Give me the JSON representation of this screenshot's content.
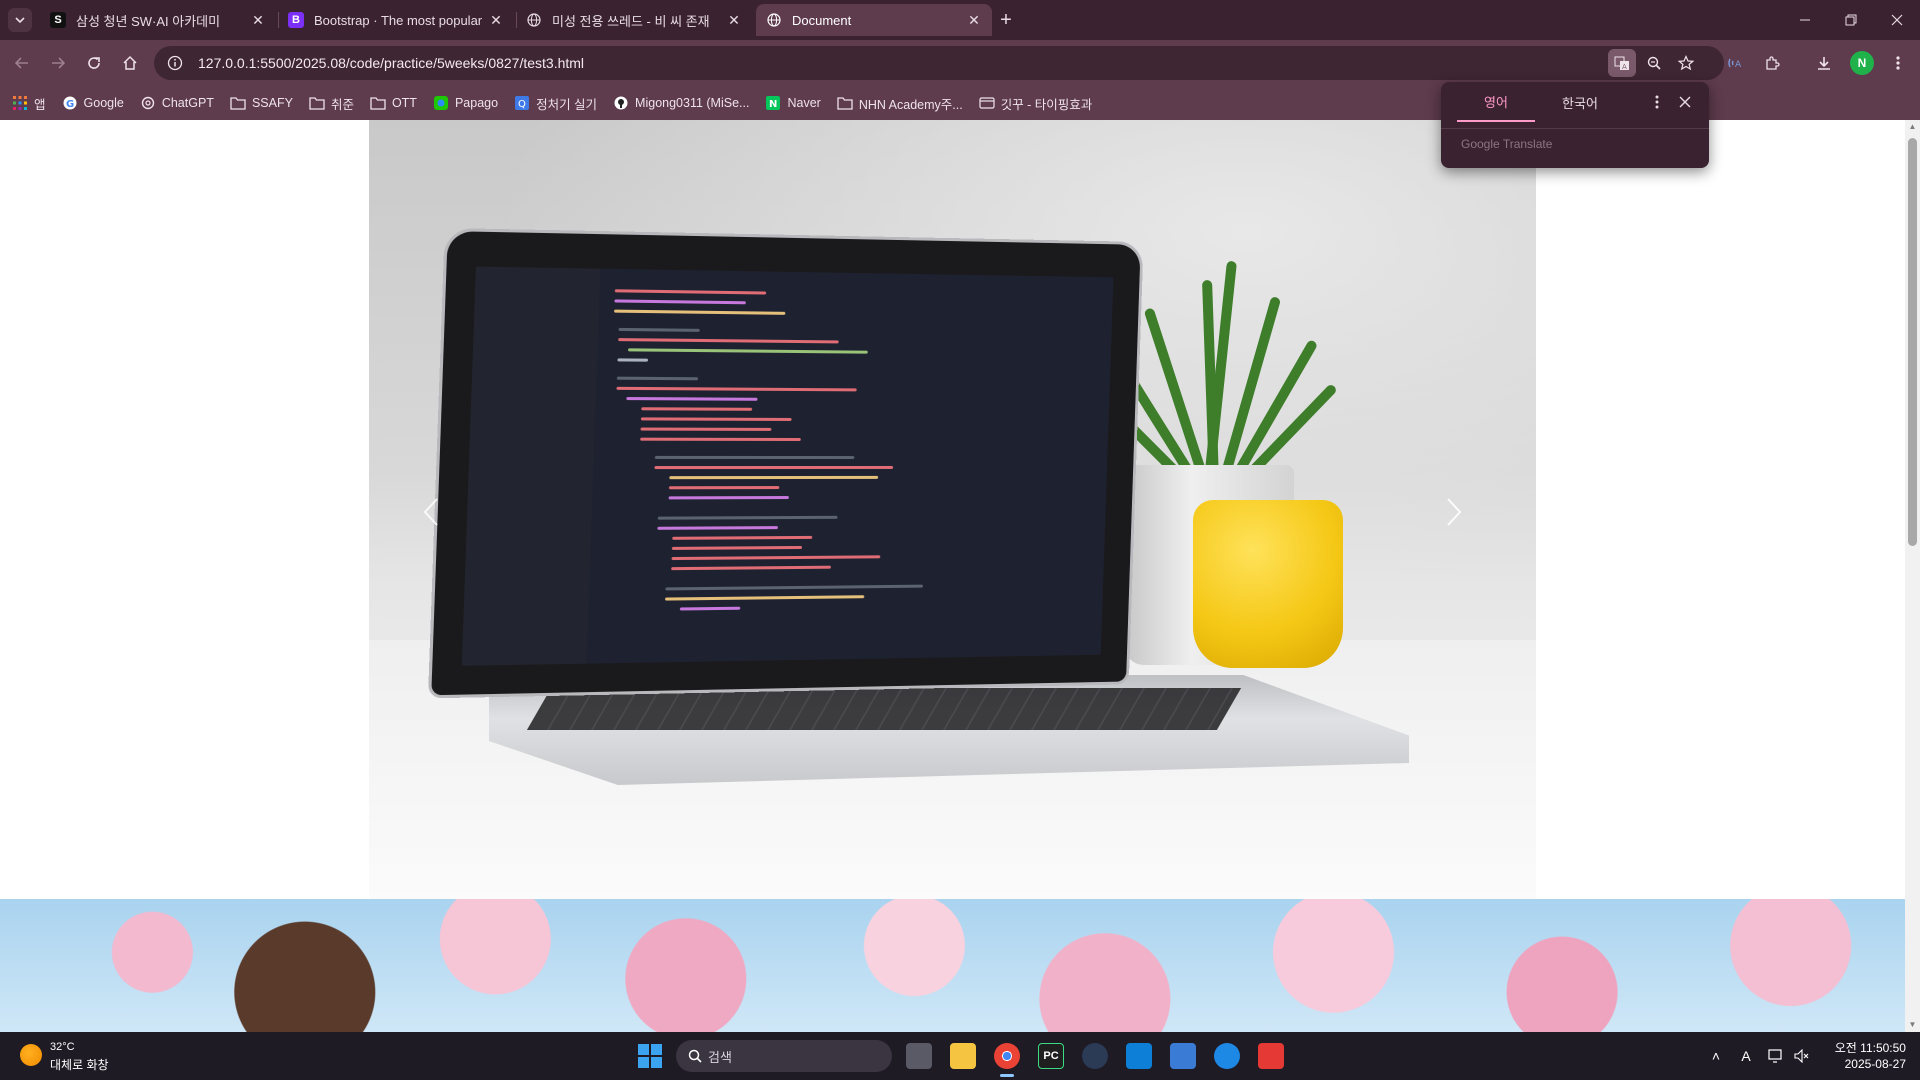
{
  "browser": {
    "tabs": [
      {
        "title": "삼성 청년 SW·AI 아카데미",
        "favicon": "S",
        "favicon_color": "#111111",
        "active": false
      },
      {
        "title": "Bootstrap · The most popular",
        "favicon": "B",
        "favicon_color": "#7b2ff7",
        "active": false
      },
      {
        "title": "미성 전용 쓰레드 - 비 씨 존재",
        "favicon": "",
        "favicon_color": "#999999",
        "active": false
      },
      {
        "title": "Document",
        "favicon": "",
        "favicon_color": "#999999",
        "active": true
      }
    ],
    "url": "127.0.0.1:5500/2025.08/code/practice/5weeks/0827/test3.html",
    "profile_initial": "N",
    "bookmarks": [
      {
        "label": "앱",
        "icon": "apps-grid-icon"
      },
      {
        "label": "Google",
        "icon": "google-icon"
      },
      {
        "label": "ChatGPT",
        "icon": "chatgpt-icon"
      },
      {
        "label": "SSAFY",
        "icon": "folder-icon"
      },
      {
        "label": "취준",
        "icon": "folder-icon"
      },
      {
        "label": "OTT",
        "icon": "folder-icon"
      },
      {
        "label": "Papago",
        "icon": "papago-icon"
      },
      {
        "label": "정처기 실기",
        "icon": "quiz-icon"
      },
      {
        "label": "Migong0311 (MiSe...",
        "icon": "github-icon"
      },
      {
        "label": "Naver",
        "icon": "naver-icon"
      },
      {
        "label": "NHN Academy주...",
        "icon": "folder-icon"
      },
      {
        "label": "깃꾸 - 타이핑효과",
        "icon": "card-icon"
      }
    ]
  },
  "translate_popup": {
    "source_lang": "영어",
    "target_lang": "한국어",
    "brand": "Google Translate"
  },
  "taskbar": {
    "weather_temp": "32°C",
    "weather_desc": "대체로 화창",
    "search_placeholder": "검색",
    "time": "오전 11:50:50",
    "date": "2025-08-27"
  },
  "colors": {
    "chrome_dark": "#3a2230",
    "chrome_toolbar": "#5e3b4d",
    "accent_pink": "#ff9ac9",
    "taskbar": "#1f1b25"
  }
}
